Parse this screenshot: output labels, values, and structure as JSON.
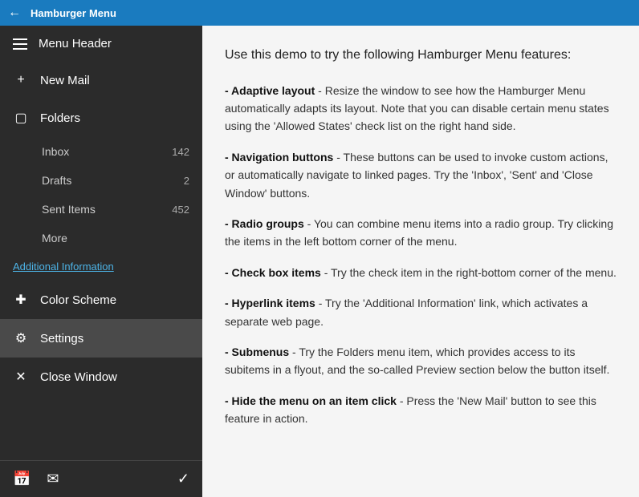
{
  "titleBar": {
    "title": "Hamburger Menu",
    "backIcon": "←"
  },
  "sidebar": {
    "headerLabel": "Menu Header",
    "items": [
      {
        "id": "new-mail",
        "label": "New Mail",
        "icon": "+"
      },
      {
        "id": "folders",
        "label": "Folders",
        "icon": "☐"
      },
      {
        "id": "settings",
        "label": "Settings",
        "icon": "⚙",
        "active": true
      },
      {
        "id": "close-window",
        "label": "Close Window",
        "icon": "✕"
      },
      {
        "id": "color-scheme",
        "label": "Color Scheme",
        "icon": "⊞"
      }
    ],
    "subItems": [
      {
        "id": "inbox",
        "label": "Inbox",
        "count": "142"
      },
      {
        "id": "drafts",
        "label": "Drafts",
        "count": "2"
      },
      {
        "id": "sent-items",
        "label": "Sent Items",
        "count": "452"
      },
      {
        "id": "more",
        "label": "More",
        "count": ""
      }
    ],
    "additionalInfo": "Additional Information",
    "bottomIcons": {
      "calendar": "📅",
      "mail": "✉",
      "check": "✓"
    }
  },
  "content": {
    "heading": "Use this demo to try the following Hamburger Menu features:",
    "paragraphs": [
      {
        "boldPart": "Adaptive layout",
        "rest": " - Resize the window to see how the Hamburger Menu automatically adapts its layout. Note that you can disable certain menu states using the 'Allowed States' check list on the right hand side."
      },
      {
        "boldPart": "Navigation buttons",
        "rest": " - These buttons can be used to invoke custom actions, or automatically navigate to linked pages. Try the 'Inbox', 'Sent' and 'Close Window' buttons."
      },
      {
        "boldPart": "Radio groups",
        "rest": " - You can combine menu items into a radio group. Try clicking the items in the left bottom corner of the menu."
      },
      {
        "boldPart": "Check box items",
        "rest": " - Try the check item in the right-bottom corner of the menu."
      },
      {
        "boldPart": "Hyperlink items",
        "rest": " - Try the 'Additional Information' link, which activates a separate web page."
      },
      {
        "boldPart": "Submenus",
        "rest": " - Try the Folders menu item, which provides access to its subitems in a flyout, and the so-called Preview section below the button itself."
      },
      {
        "boldPart": "Hide the menu on an item click",
        "rest": " - Press the 'New Mail' button to see this feature in action."
      }
    ]
  }
}
